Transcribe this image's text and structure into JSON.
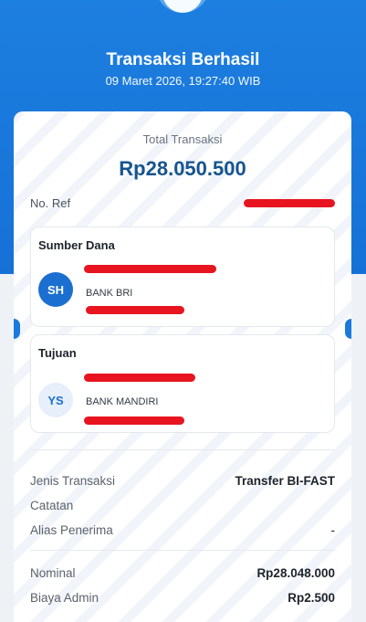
{
  "header": {
    "title": "Transaksi Berhasil",
    "datetime": "09 Maret 2026, 19:27:40 WIB"
  },
  "summary": {
    "total_label": "Total Transaksi",
    "total_amount": "Rp28.050.500",
    "ref_label": "No. Ref"
  },
  "source": {
    "title": "Sumber Dana",
    "initials": "SH",
    "bank": "BANK BRI"
  },
  "destination": {
    "title": "Tujuan",
    "initials": "YS",
    "bank": "BANK MANDIRI"
  },
  "details": [
    {
      "label": "Jenis Transaksi",
      "value": "Transfer BI-FAST"
    },
    {
      "label": "Catatan",
      "value": ""
    },
    {
      "label": "Alias Penerima",
      "value": "-"
    }
  ],
  "amounts": [
    {
      "label": "Nominal",
      "value": "Rp28.048.000"
    },
    {
      "label": "Biaya Admin",
      "value": "Rp2.500"
    }
  ],
  "colors": {
    "primary": "#1b79dc",
    "amount_text": "#16548f",
    "redaction": "#e8141f"
  }
}
